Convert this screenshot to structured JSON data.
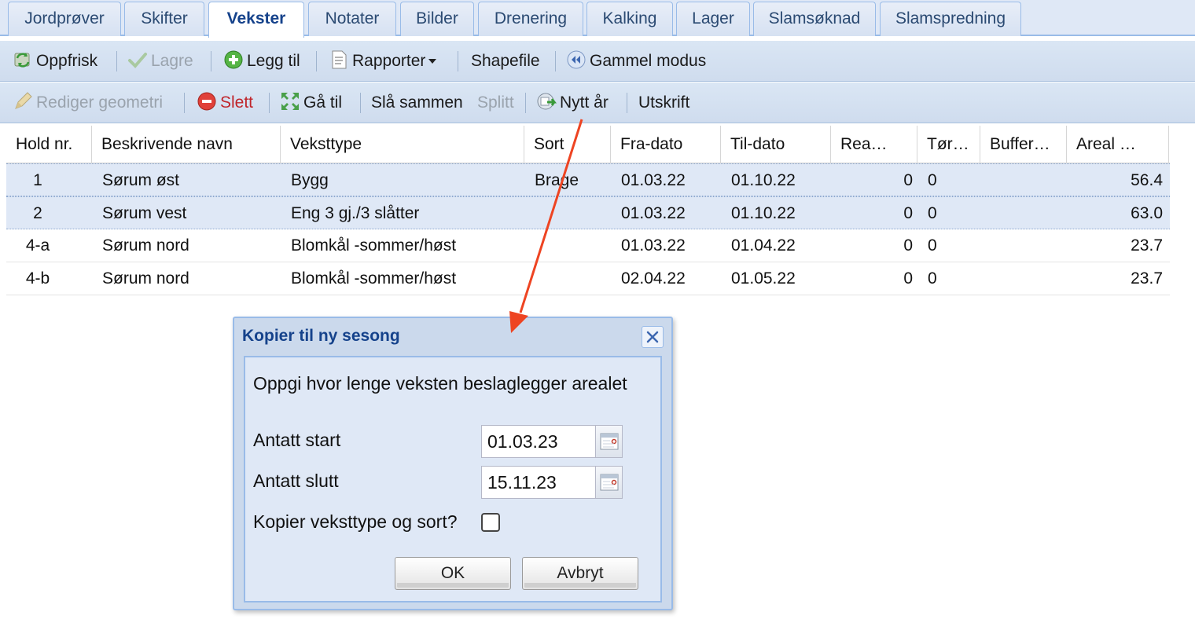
{
  "tabs": [
    {
      "label": "Jordprøver",
      "active": false
    },
    {
      "label": "Skifter",
      "active": false
    },
    {
      "label": "Vekster",
      "active": true
    },
    {
      "label": "Notater",
      "active": false
    },
    {
      "label": "Bilder",
      "active": false
    },
    {
      "label": "Drenering",
      "active": false
    },
    {
      "label": "Kalking",
      "active": false
    },
    {
      "label": "Lager",
      "active": false
    },
    {
      "label": "Slamsøknad",
      "active": false
    },
    {
      "label": "Slamspredning",
      "active": false
    }
  ],
  "toolbar1": {
    "refresh": {
      "label": "Oppfrisk",
      "icon": "refresh-icon"
    },
    "save": {
      "label": "Lagre",
      "icon": "checkmark-icon",
      "disabled": true
    },
    "add": {
      "label": "Legg til",
      "icon": "add-circle-icon"
    },
    "reports": {
      "label": "Rapporter",
      "icon": "document-icon",
      "dropdown": true
    },
    "shapefile": {
      "label": "Shapefile"
    },
    "legacy": {
      "label": "Gammel modus",
      "icon": "rewind-icon"
    }
  },
  "toolbar2": {
    "edit_geometry": {
      "label": "Rediger geometri",
      "icon": "pencil-icon",
      "disabled": true
    },
    "delete": {
      "label": "Slett",
      "icon": "delete-circle-icon",
      "color": "#c0252a"
    },
    "goto": {
      "label": "Gå til",
      "icon": "arrows-in-icon"
    },
    "merge": {
      "label": "Slå sammen"
    },
    "split": {
      "label": "Splitt",
      "disabled": true
    },
    "new_year": {
      "label": "Nytt år",
      "icon": "new-year-icon"
    },
    "print": {
      "label": "Utskrift"
    }
  },
  "grid": {
    "columns": [
      "Hold nr.",
      "Beskrivende navn",
      "Veksttype",
      "Sort",
      "Fra-dato",
      "Til-dato",
      "Rea…",
      "Tør…",
      "Buffer…",
      "Areal …"
    ],
    "rows": [
      {
        "hold": "1",
        "name": "Sørum øst",
        "type": "Bygg",
        "sort": "Brage",
        "from": "01.03.22",
        "to": "01.10.22",
        "rea": "0",
        "tor": "0",
        "buffer": "",
        "area": "56.4",
        "selected": true
      },
      {
        "hold": "2",
        "name": "Sørum vest",
        "type": "Eng 3 gj./3 slåtter",
        "sort": "",
        "from": "01.03.22",
        "to": "01.10.22",
        "rea": "0",
        "tor": "0",
        "buffer": "",
        "area": "63.0",
        "selected": true
      },
      {
        "hold": "4-a",
        "name": "Sørum nord",
        "type": "Blomkål -sommer/høst",
        "sort": "",
        "from": "01.03.22",
        "to": "01.04.22",
        "rea": "0",
        "tor": "0",
        "buffer": "",
        "area": "23.7",
        "selected": false
      },
      {
        "hold": "4-b",
        "name": "Sørum nord",
        "type": "Blomkål -sommer/høst",
        "sort": "",
        "from": "02.04.22",
        "to": "01.05.22",
        "rea": "0",
        "tor": "0",
        "buffer": "",
        "area": "23.7",
        "selected": false
      }
    ]
  },
  "dialog": {
    "title": "Kopier til ny sesong",
    "instruction": "Oppgi hvor lenge veksten beslaglegger arealet",
    "start_label": "Antatt start",
    "start_value": "01.03.23",
    "end_label": "Antatt slutt",
    "end_value": "15.11.23",
    "copy_label": "Kopier veksttype og sort?",
    "copy_checked": false,
    "ok_label": "OK",
    "cancel_label": "Avbryt"
  },
  "annotation": {
    "color": "#ee4422"
  }
}
